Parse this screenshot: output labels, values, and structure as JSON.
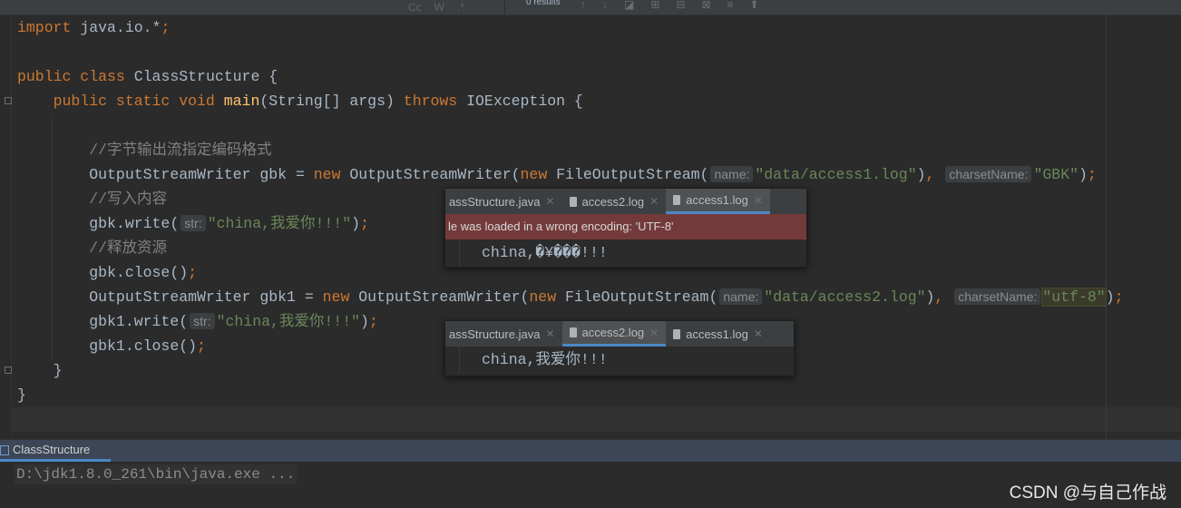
{
  "toolbar": {
    "search_results": "0 results",
    "match_case": "Cc",
    "words": "W",
    "regex": ".*"
  },
  "code_lines": [
    [
      [
        "kw",
        "import "
      ],
      [
        "pl",
        "java.io.*"
      ],
      [
        "kw",
        ";"
      ]
    ],
    [],
    [
      [
        "kw",
        "public class "
      ],
      [
        "pl",
        "ClassStructure {"
      ]
    ],
    [
      [
        "pl",
        "    "
      ],
      [
        "kw",
        "public static void "
      ],
      [
        "fn",
        "main"
      ],
      [
        "pl",
        "(String[] args) "
      ],
      [
        "kw",
        "throws "
      ],
      [
        "pl",
        "IOException {"
      ]
    ],
    [],
    [
      [
        "pl",
        "        "
      ],
      [
        "cm",
        "//字节输出流指定编码格式"
      ]
    ],
    [
      [
        "pl",
        "        OutputStreamWriter gbk = "
      ],
      [
        "kw",
        "new "
      ],
      [
        "pl",
        "OutputStreamWriter("
      ],
      [
        "kw",
        "new "
      ],
      [
        "pl",
        "FileOutputStream("
      ],
      [
        "hint",
        "name:"
      ],
      [
        "str",
        "\"data/access1.log\""
      ],
      [
        "pl",
        ")"
      ],
      [
        "kw",
        ", "
      ],
      [
        "hint",
        "charsetName:"
      ],
      [
        "str",
        "\"GBK\""
      ],
      [
        "pl",
        ")"
      ],
      [
        "kw",
        ";"
      ]
    ],
    [
      [
        "pl",
        "        "
      ],
      [
        "cm",
        "//写入内容"
      ]
    ],
    [
      [
        "pl",
        "        gbk.write("
      ],
      [
        "hint",
        "str:"
      ],
      [
        "str",
        "\"china,我爱你!!!\""
      ],
      [
        "pl",
        ")"
      ],
      [
        "kw",
        ";"
      ]
    ],
    [
      [
        "pl",
        "        "
      ],
      [
        "cm",
        "//释放资源"
      ]
    ],
    [
      [
        "pl",
        "        gbk.close()"
      ],
      [
        "kw",
        ";"
      ]
    ],
    [
      [
        "pl",
        "        OutputStreamWriter gbk1 = "
      ],
      [
        "kw",
        "new "
      ],
      [
        "pl",
        "OutputStreamWriter("
      ],
      [
        "kw",
        "new "
      ],
      [
        "pl",
        "FileOutputStream("
      ],
      [
        "hint",
        "name:"
      ],
      [
        "str",
        "\"data/access2.log\""
      ],
      [
        "pl",
        ")"
      ],
      [
        "kw",
        ", "
      ],
      [
        "hint",
        "charsetName:"
      ],
      [
        "strhl",
        "\"utf-8\""
      ],
      [
        "pl",
        ")"
      ],
      [
        "kw",
        ";"
      ]
    ],
    [
      [
        "pl",
        "        gbk1.write("
      ],
      [
        "hint",
        "str:"
      ],
      [
        "str",
        "\"china,我爱你!!!\""
      ],
      [
        "pl",
        ")"
      ],
      [
        "kw",
        ";"
      ]
    ],
    [
      [
        "pl",
        "        gbk1.close()"
      ],
      [
        "kw",
        ";"
      ]
    ],
    [
      [
        "pl",
        "    }"
      ]
    ],
    [
      [
        "pl",
        "}"
      ]
    ]
  ],
  "popup1": {
    "tabs": [
      "assStructure.java",
      "access2.log",
      "access1.log"
    ],
    "active": 2,
    "warning": "le was loaded in a wrong encoding: 'UTF-8'",
    "content": "china,�¥���!!!"
  },
  "popup2": {
    "tabs": [
      "assStructure.java",
      "access2.log",
      "access1.log"
    ],
    "active": 1,
    "content": "china,我爱你!!!"
  },
  "run_panel": {
    "tab": "ClassStructure",
    "console": "D:\\jdk1.8.0_261\\bin\\java.exe ..."
  },
  "watermark": "CSDN @与自己作战"
}
